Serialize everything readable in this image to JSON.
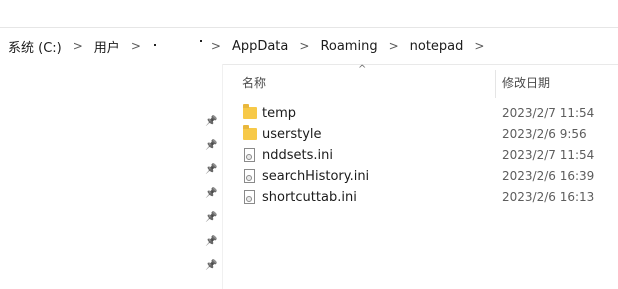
{
  "address_bar": {
    "crumbs": [
      {
        "label": "系统 (C:)"
      },
      {
        "label": "用户"
      },
      {
        "label": ""
      },
      {
        "label": "AppData"
      },
      {
        "label": "Roaming"
      },
      {
        "label": "notepad"
      }
    ],
    "separator": ">"
  },
  "nav_pane": {
    "pin_icon": "pin-icon",
    "pin_glyph": "📌",
    "pin_count": 7
  },
  "columns": {
    "name": "名称",
    "date": "修改日期"
  },
  "files": [
    {
      "name": "temp",
      "type": "folder",
      "date": "2023/2/7 11:54"
    },
    {
      "name": "userstyle",
      "type": "folder",
      "date": "2023/2/6 9:56"
    },
    {
      "name": "nddsets.ini",
      "type": "ini",
      "date": "2023/2/7 11:54"
    },
    {
      "name": "searchHistory.ini",
      "type": "ini",
      "date": "2023/2/6 16:39"
    },
    {
      "name": "shortcuttab.ini",
      "type": "ini",
      "date": "2023/2/6 16:13"
    }
  ],
  "colors": {
    "folder": "#f7c948",
    "text": "#1b1b1b",
    "date_text": "#5d5d5d"
  }
}
